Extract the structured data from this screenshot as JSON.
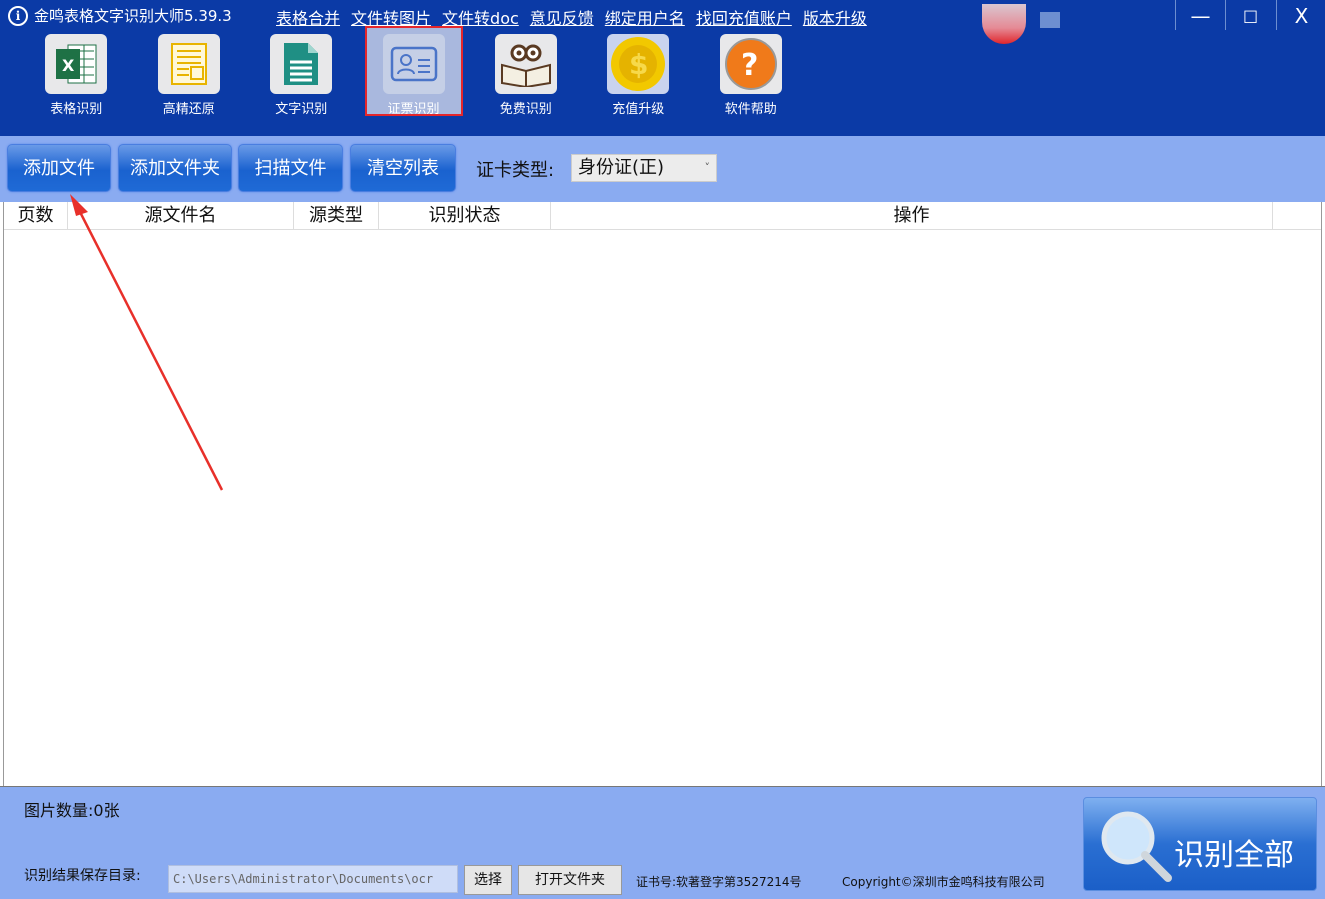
{
  "app": {
    "title": "金鸣表格文字识别大师5.39.3"
  },
  "links": [
    "表格合并",
    "文件转图片",
    "文件转doc",
    "意见反馈",
    "绑定用户名",
    "找回充值账户",
    "版本升级"
  ],
  "window": {
    "minimize": "—",
    "maximize": "□",
    "close": "X"
  },
  "tools": [
    {
      "label": "表格识别",
      "icon": "excel-icon"
    },
    {
      "label": "高精还原",
      "icon": "layout-icon"
    },
    {
      "label": "文字识别",
      "icon": "document-icon"
    },
    {
      "label": "证票识别",
      "icon": "id-card-icon",
      "selected": true
    },
    {
      "label": "免费识别",
      "icon": "book-owl-icon"
    },
    {
      "label": "充值升级",
      "icon": "coin-icon"
    },
    {
      "label": "软件帮助",
      "icon": "help-icon"
    }
  ],
  "toolbar": {
    "add_file": "添加文件",
    "add_folder": "添加文件夹",
    "scan_file": "扫描文件",
    "clear_list": "清空列表",
    "card_type_label": "证卡类型:",
    "card_type_value": "身份证(正)"
  },
  "table": {
    "columns": [
      "页数",
      "源文件名",
      "源类型",
      "识别状态",
      "操作"
    ],
    "rows": []
  },
  "footer": {
    "image_count": "图片数量:0张",
    "save_dir_label": "识别结果保存目录:",
    "save_dir_value": "C:\\Users\\Administrator\\Documents\\ocr",
    "choose": "选择",
    "open_folder": "打开文件夹",
    "cert": "证书号:软著登字第3527214号",
    "copyright": "Copyright©深圳市金鸣科技有限公司",
    "recognize_all": "识别全部"
  },
  "colors": {
    "header": "#0b3aa6",
    "band": "#8aabf1",
    "highlight": "#e5262b"
  }
}
